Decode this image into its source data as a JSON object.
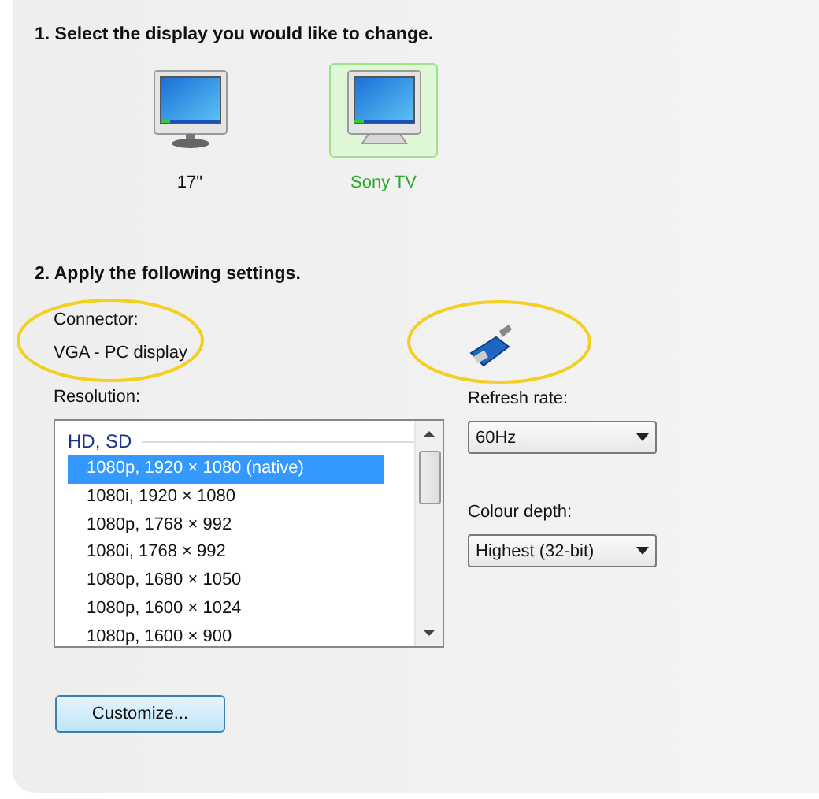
{
  "step1": {
    "heading": "1. Select the display you would like to change."
  },
  "displays": [
    {
      "label": "17\"",
      "selected": false
    },
    {
      "label": "Sony TV",
      "selected": true
    }
  ],
  "step2": {
    "heading": "2. Apply the following settings."
  },
  "connector": {
    "label": "Connector:",
    "value": "VGA - PC display"
  },
  "resolution": {
    "label": "Resolution:",
    "group": "HD, SD",
    "items": [
      {
        "text": "1080p, 1920 × 1080 (native)",
        "selected": true
      },
      {
        "text": "1080i, 1920 × 1080",
        "selected": false
      },
      {
        "text": "1080p, 1768 × 992",
        "selected": false
      },
      {
        "text": "1080i, 1768 × 992",
        "selected": false
      },
      {
        "text": "1080p, 1680 × 1050",
        "selected": false
      },
      {
        "text": "1080p, 1600 × 1024",
        "selected": false
      },
      {
        "text": "1080p, 1600 × 900",
        "selected": false
      }
    ]
  },
  "refresh_rate": {
    "label": "Refresh rate:",
    "value": "60Hz"
  },
  "colour_depth": {
    "label": "Colour depth:",
    "value": "Highest (32-bit)"
  },
  "buttons": [
    "Customize..."
  ],
  "annotations": [
    {
      "kind": "ellipse"
    },
    {
      "kind": "ellipse"
    }
  ]
}
